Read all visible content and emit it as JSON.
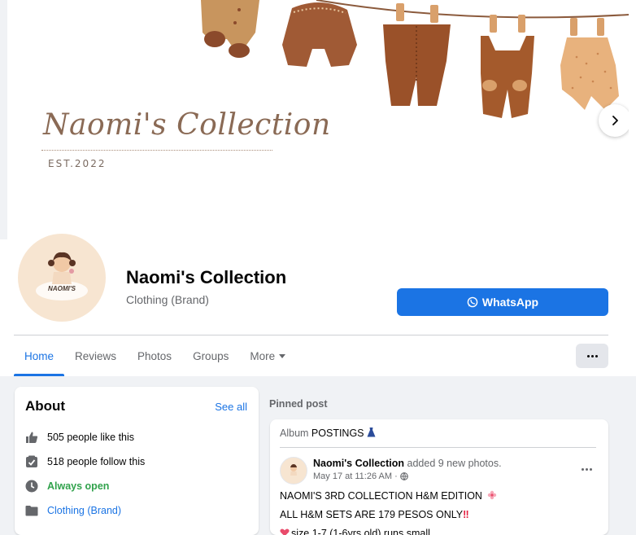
{
  "cover": {
    "script_title": "Naomi's Collection",
    "est": "EST.2022"
  },
  "profile": {
    "avatar_text": "NAOMI'S",
    "name": "Naomi's Collection",
    "category": "Clothing (Brand)",
    "whatsapp_label": "WhatsApp"
  },
  "tabs": [
    {
      "label": "Home",
      "active": true
    },
    {
      "label": "Reviews"
    },
    {
      "label": "Photos"
    },
    {
      "label": "Groups"
    },
    {
      "label": "More"
    }
  ],
  "about": {
    "title": "About",
    "see_all": "See all",
    "likes": "505 people like this",
    "follows": "518 people follow this",
    "hours": "Always open",
    "category": "Clothing (Brand)"
  },
  "pinned": {
    "label": "Pinned post",
    "album_prefix": "Album",
    "album_name": "POSTINGS",
    "author": "Naomi's Collection",
    "action": "added 9 new photos.",
    "time": "May 17 at 11:26 AM ·",
    "line1": "NAOMI'S 3RD COLLECTION H&M EDITION",
    "line2": "ALL H&M SETS ARE 179 PESOS ONLY",
    "line2_mark": "‼",
    "line3": "size 1-7 (1-6yrs old) runs small"
  },
  "colors": {
    "accent": "#1b74e4",
    "green": "#31a24c",
    "background": "#f0f2f5"
  }
}
